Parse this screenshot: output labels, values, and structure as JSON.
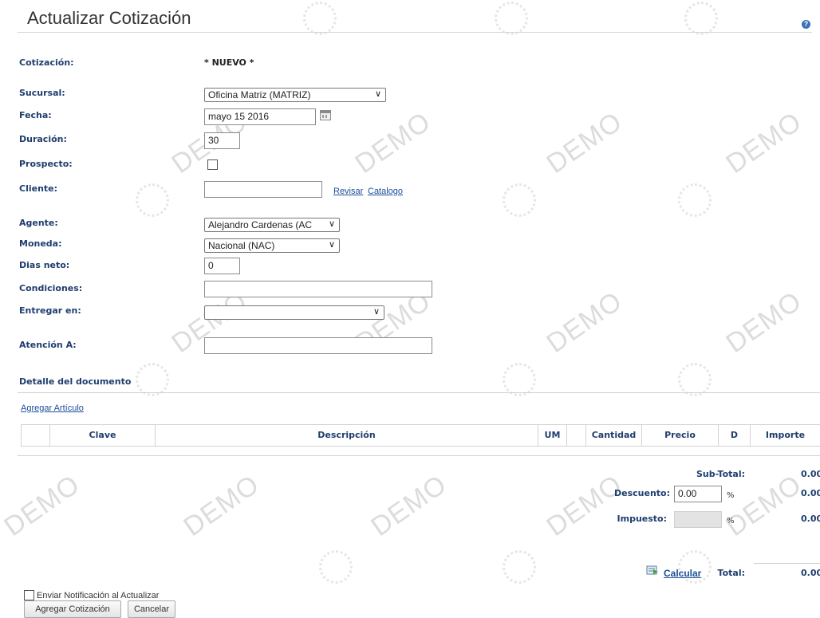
{
  "page": {
    "title": "Actualizar Cotización",
    "help_icon": "help-icon",
    "watermark": "DEMO"
  },
  "form": {
    "cotizacion_label": "Cotización:",
    "cotizacion_value": "* NUEVO *",
    "sucursal_label": "Sucursal:",
    "sucursal_value": "Oficina Matriz (MATRIZ)",
    "fecha_label": "Fecha:",
    "fecha_value": "mayo 15 2016",
    "duracion_label": "Duración:",
    "duracion_value": "30",
    "prospecto_label": "Prospecto:",
    "prospecto_checked": false,
    "cliente_label": "Cliente:",
    "cliente_value": "",
    "revisar_link": "Revisar",
    "catalogo_link": "Catalogo",
    "agente_label": "Agente:",
    "agente_value": "Alejandro Cardenas (AC",
    "moneda_label": "Moneda:",
    "moneda_value": "Nacional (NAC)",
    "dias_label": "Dias neto:",
    "dias_value": "0",
    "condiciones_label": "Condiciones:",
    "condiciones_value": "",
    "entregar_label": "Entregar en:",
    "entregar_value": "",
    "atencion_label": "Atención A:",
    "atencion_value": ""
  },
  "detalle": {
    "section_title": "Detalle del documento",
    "add_link": "Agregar Artículo",
    "columns": [
      "",
      "Clave",
      "Descripción",
      "UM",
      "",
      "Cantidad",
      "Precio",
      "D",
      "Importe"
    ]
  },
  "totals": {
    "subtotal_label": "Sub-Total:",
    "subtotal_value": "0.00",
    "descuento_label": "Descuento:",
    "descuento_input": "0.00",
    "descuento_pct": "%",
    "descuento_value": "0.00",
    "impuesto_label": "Impuesto:",
    "impuesto_pct": "%",
    "impuesto_value": "0.00",
    "calcular_link": "Calcular",
    "total_label": "Total:",
    "total_value": "0.00"
  },
  "footer": {
    "notify_label": "Enviar Notificación al Actualizar",
    "add_button": "Agregar Cotización",
    "cancel_button": "Cancelar"
  }
}
